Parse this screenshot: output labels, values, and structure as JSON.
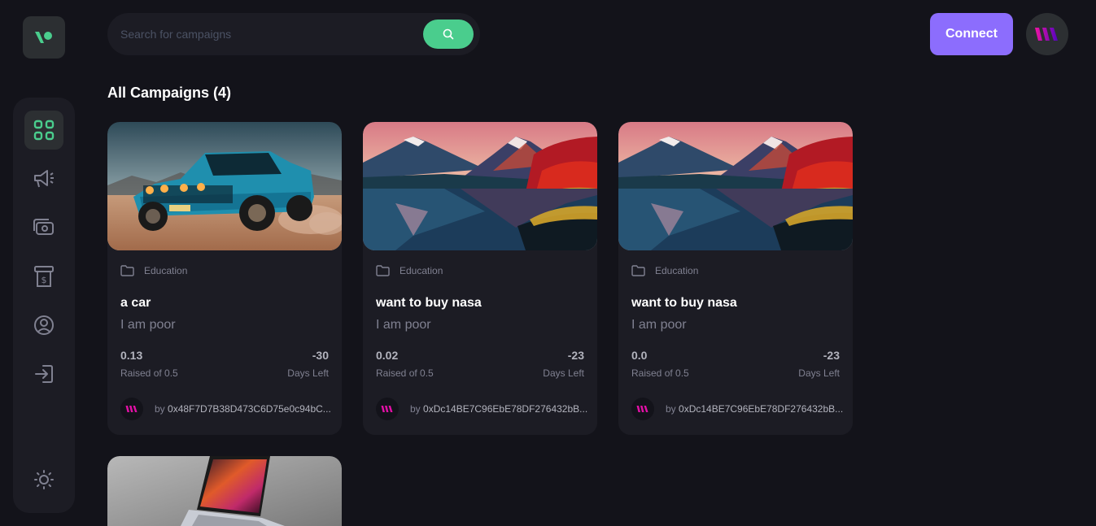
{
  "app": {
    "logo_icon": "logo-icon"
  },
  "sidebar": {
    "items": [
      {
        "name": "dashboard-icon",
        "active": true
      },
      {
        "name": "megaphone-icon"
      },
      {
        "name": "payment-icon"
      },
      {
        "name": "withdraw-icon"
      },
      {
        "name": "profile-icon"
      },
      {
        "name": "logout-icon"
      }
    ],
    "theme_icon": "sun-icon"
  },
  "header": {
    "search_placeholder": "Search for campaigns",
    "search_value": "",
    "connect_label": "Connect"
  },
  "main": {
    "title": "All Campaigns (4)",
    "campaigns": [
      {
        "category": "Education",
        "title": "a car",
        "description": "I am poor",
        "raised": "0.13",
        "raised_label": "Raised of 0.5",
        "days": "-30",
        "days_label": "Days Left",
        "by": "by ",
        "owner": "0x48F7D7B38D473C6D75e0c94bC...",
        "image": "blue-muscle-car"
      },
      {
        "category": "Education",
        "title": "want to buy nasa",
        "description": "I am poor",
        "raised": "0.02",
        "raised_label": "Raised of 0.5",
        "days": "-23",
        "days_label": "Days Left",
        "by": "by ",
        "owner": "0xDc14BE7C96EbE78DF276432bB...",
        "image": "mountain-lake"
      },
      {
        "category": "Education",
        "title": "want to buy nasa",
        "description": "I am poor",
        "raised": "0.0",
        "raised_label": "Raised of 0.5",
        "days": "-23",
        "days_label": "Days Left",
        "by": "by ",
        "owner": "0xDc14BE7C96EbE78DF276432bB...",
        "image": "mountain-lake"
      }
    ]
  },
  "colors": {
    "accent": "#4acd8d",
    "connect": "#8c6dfd",
    "bg": "#13131a",
    "card": "#1c1c24"
  }
}
